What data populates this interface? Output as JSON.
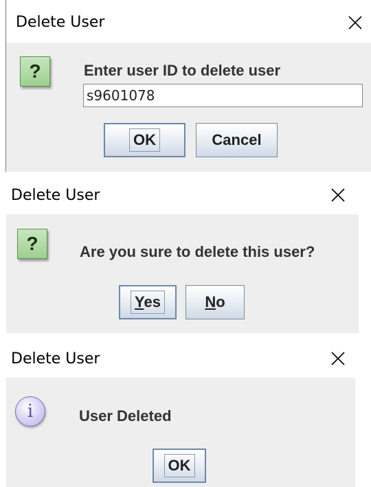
{
  "dialogs": [
    {
      "title": "Delete User",
      "close_glyph": "✕",
      "icon": "question-icon",
      "icon_glyph": "?",
      "message": "Enter user ID to delete user",
      "input_value": "s9601078",
      "buttons": [
        {
          "label": "OK"
        },
        {
          "label": "Cancel"
        }
      ]
    },
    {
      "title": "Delete User",
      "close_glyph": "✕",
      "icon": "question-icon",
      "icon_glyph": "?",
      "message": "Are you sure to delete this user?",
      "buttons": [
        {
          "label_mnemonic": "Y",
          "label_rest": "es"
        },
        {
          "label_mnemonic": "N",
          "label_rest": "o"
        }
      ]
    },
    {
      "title": "Delete User",
      "close_glyph": "✕",
      "icon": "information-icon",
      "icon_glyph": "i",
      "message": "User Deleted",
      "buttons": [
        {
          "label": "OK"
        }
      ]
    }
  ],
  "colors": {
    "panel_bg": "#eeeeee",
    "question_icon_green": "#9fd08f",
    "info_icon_purple": "#b7b0e6",
    "message_text": "#333333"
  }
}
